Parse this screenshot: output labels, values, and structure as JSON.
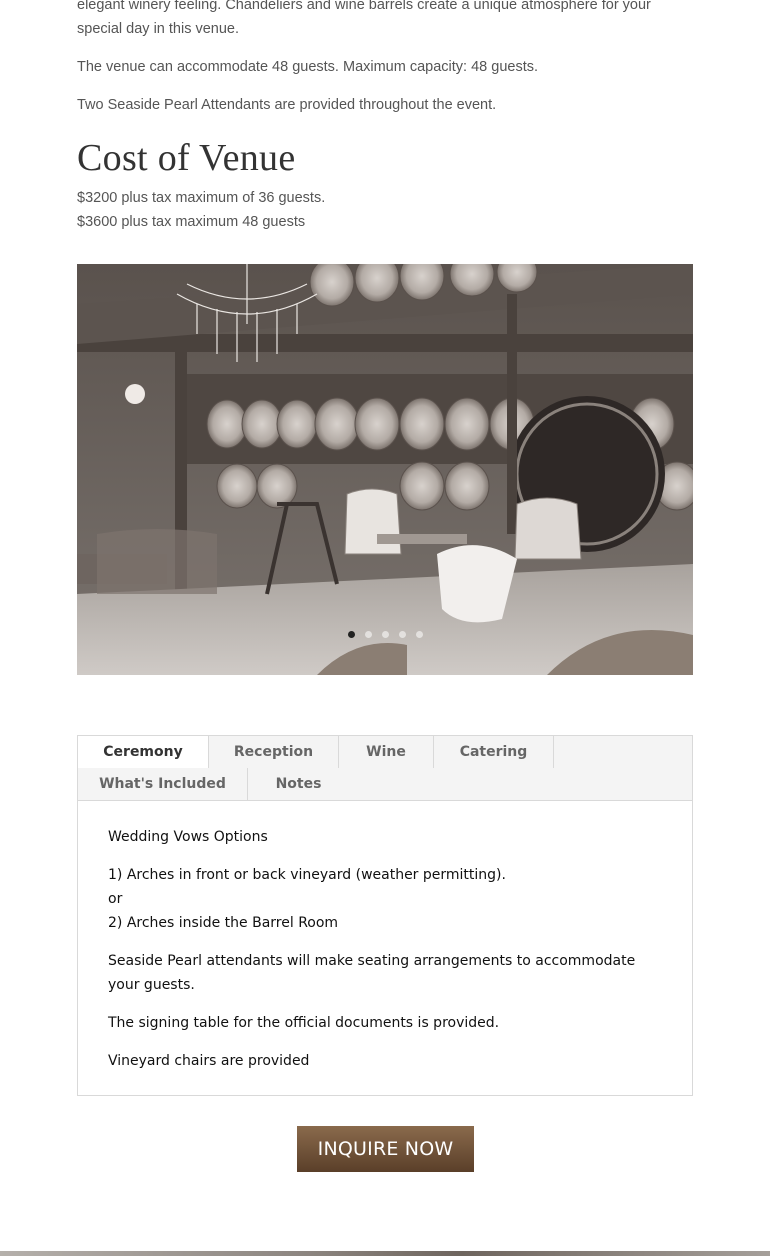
{
  "intro": {
    "paragraph1": "elegant winery feeling. Chandeliers and wine barrels create a unique atmosphere for your special day in this venue.",
    "paragraph2": "The venue can accommodate 48 guests. Maximum capacity: 48 guests.",
    "paragraph3": "Two Seaside Pearl Attendants are provided throughout the event."
  },
  "cost": {
    "heading": "Cost of Venue",
    "line1": "$3200 plus tax maximum of 36 guests.",
    "line2": "$3600 plus tax maximum 48 guests"
  },
  "slider": {
    "slide_count": 5,
    "active_slide": 1
  },
  "tabs": {
    "items": [
      {
        "label": "Ceremony",
        "active": true
      },
      {
        "label": "Reception",
        "active": false
      },
      {
        "label": "Wine",
        "active": false
      },
      {
        "label": "Catering",
        "active": false
      },
      {
        "label": "What's Included",
        "active": false
      },
      {
        "label": "Notes",
        "active": false
      }
    ],
    "content": {
      "title": "Wedding Vows Options",
      "option1": "1) Arches in front or back vineyard (weather permitting).",
      "or": "or",
      "option2": "2) Arches inside the Barrel Room",
      "seating": "Seaside Pearl attendants will make seating arrangements to accommodate your guests.",
      "signing": "The signing table for the official documents is provided.",
      "chairs": "Vineyard chairs are provided"
    }
  },
  "cta": {
    "label": "INQUIRE NOW"
  },
  "colors": {
    "button_top": "#8a6a4c",
    "button_bottom": "#5a3f29",
    "tab_bar": "#f4f4f4"
  }
}
